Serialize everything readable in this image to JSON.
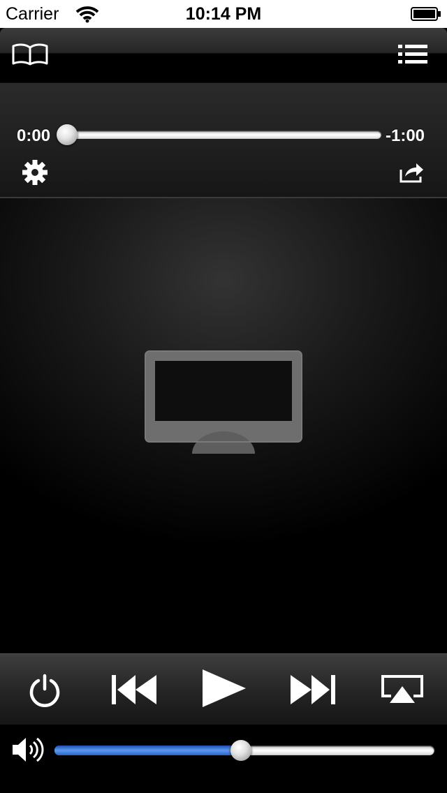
{
  "status_bar": {
    "carrier": "Carrier",
    "time": "10:14 PM"
  },
  "navbar": {
    "left_icon": "book-icon",
    "right_icon": "list-icon"
  },
  "playback": {
    "elapsed": "0:00",
    "remaining": "-1:00",
    "progress_fraction": 0.0,
    "settings_icon": "gear-icon",
    "share_icon": "share-icon"
  },
  "artwork": {
    "icon": "display-icon"
  },
  "controls": {
    "power_icon": "power-icon",
    "previous_icon": "skip-back-icon",
    "play_icon": "play-icon",
    "next_icon": "skip-forward-icon",
    "airplay_icon": "airplay-icon"
  },
  "volume": {
    "icon": "speaker-icon",
    "level_fraction": 0.49,
    "accent_color": "#3b7ae0"
  }
}
